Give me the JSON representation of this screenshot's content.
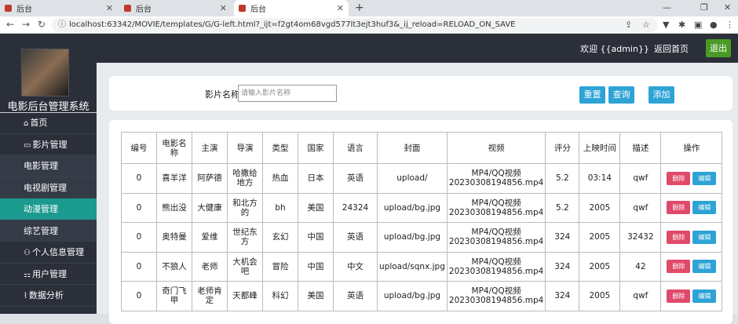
{
  "browser": {
    "tabs": [
      "后台",
      "后台",
      "后台"
    ],
    "url": "localhost:63342/MOVIE/templates/G/G-left.html?_ijt=f2gt4om68vgd577lt3ejt3huf3&_ij_reload=RELOAD_ON_SAVE",
    "new_tab": "+"
  },
  "header": {
    "welcome": "欢迎 {{admin}}",
    "home": "返回首页",
    "logout": "退出"
  },
  "sidebar": {
    "title": "电影后台管理系统",
    "items": [
      {
        "label": "首页",
        "icon": "⌂"
      },
      {
        "label": "影片管理",
        "icon": "▭"
      },
      {
        "label": "电影管理",
        "icon": ""
      },
      {
        "label": "电视剧管理",
        "icon": ""
      },
      {
        "label": "动漫管理",
        "icon": ""
      },
      {
        "label": "综艺管理",
        "icon": ""
      },
      {
        "label": "个人信息管理",
        "icon": "⚇"
      },
      {
        "label": "用户管理",
        "icon": "⚏"
      },
      {
        "label": "数据分析",
        "icon": "⌇"
      }
    ]
  },
  "search": {
    "label": "影片名称:",
    "placeholder": "请输入影片名称",
    "reset": "重置",
    "query": "查询",
    "add": "添加"
  },
  "table": {
    "headers": [
      "编号",
      "电影名称",
      "主演",
      "导演",
      "类型",
      "国家",
      "语言",
      "封面",
      "视频",
      "评分",
      "上映时间",
      "描述",
      "操作"
    ],
    "delete_label": "删除",
    "edit_label": "编辑",
    "rows": [
      [
        "0",
        "喜羊洋",
        "阿萨德",
        "哈撒给地方",
        "热血",
        "日本",
        "英语",
        "upload/",
        "MP4/QQ视频20230308194856.mp4",
        "5.2",
        "03:14",
        "qwf"
      ],
      [
        "0",
        "熊出没",
        "大健康",
        "和北方的",
        "bh",
        "美国",
        "24324",
        "upload/bg.jpg",
        "MP4/QQ视频20230308194856.mp4",
        "5.2",
        "2005",
        "qwf"
      ],
      [
        "0",
        "奥特曼",
        "爱维",
        "世纪东方",
        "玄幻",
        "中国",
        "英语",
        "upload/bg.jpg",
        "MP4/QQ视频20230308194856.mp4",
        "324",
        "2005",
        "32432"
      ],
      [
        "0",
        "不狼人",
        "老师",
        "大机会吧",
        "冒险",
        "中国",
        "中文",
        "upload/sqnx.jpg",
        "MP4/QQ视频20230308194856.mp4",
        "324",
        "2005",
        "42"
      ],
      [
        "0",
        "奇门飞甲",
        "老师肯定",
        "天都峰",
        "科幻",
        "美国",
        "英语",
        "upload/bg.jpg",
        "MP4/QQ视频20230308194856.mp4",
        "324",
        "2005",
        "qwf"
      ]
    ]
  }
}
